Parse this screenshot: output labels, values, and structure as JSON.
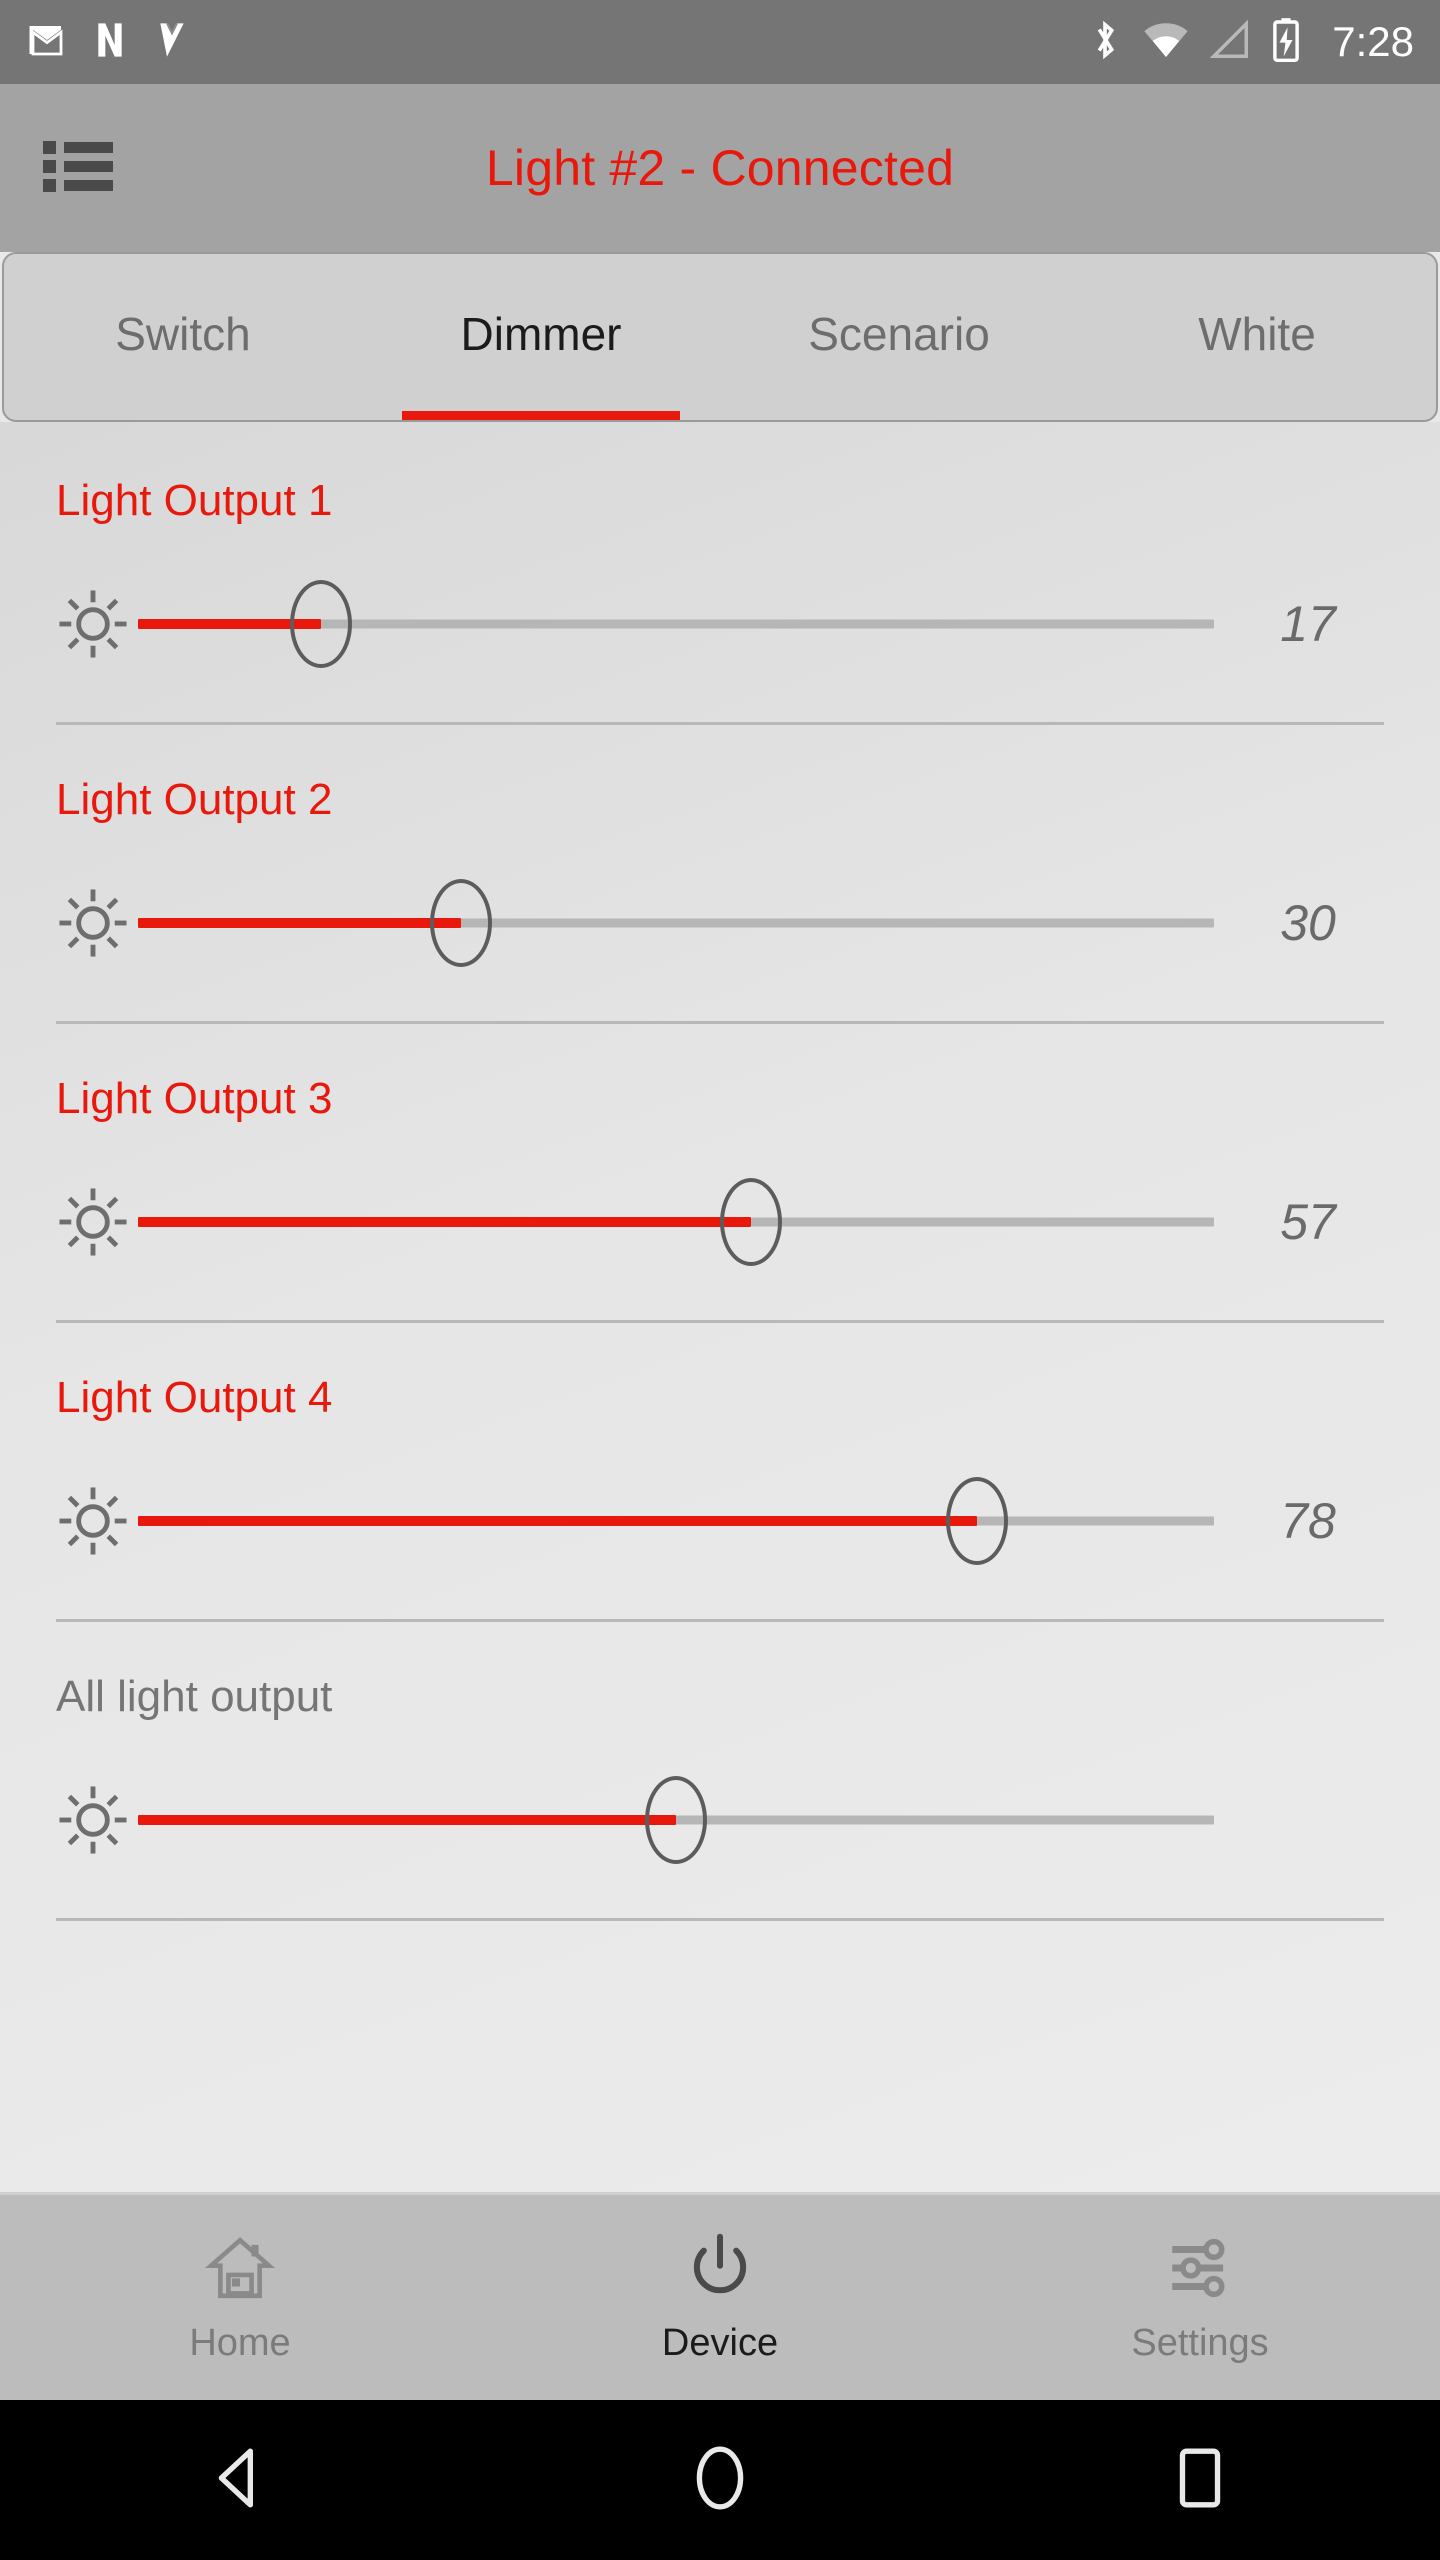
{
  "status_bar": {
    "left_icons": [
      "gmail-icon",
      "netflix-icon",
      "vlc-icon"
    ],
    "right_icons": [
      "bluetooth-icon",
      "wifi-icon",
      "cell-signal-icon",
      "battery-charging-icon"
    ],
    "time": "7:28"
  },
  "app_bar": {
    "menu_icon": "list-menu-icon",
    "title": "Light #2 - Connected",
    "title_color": "#e8180c"
  },
  "tabs": [
    {
      "label": "Switch",
      "active": false
    },
    {
      "label": "Dimmer",
      "active": true
    },
    {
      "label": "Scenario",
      "active": false
    },
    {
      "label": "White",
      "active": false
    }
  ],
  "dimmer": {
    "accent_color": "#e8180c",
    "track_color": "#b6b6b6",
    "rows": [
      {
        "label": "Light Output 1",
        "icon": "brightness-sun-icon",
        "value": "17",
        "percent": 17,
        "label_muted": false,
        "show_value": true
      },
      {
        "label": "Light Output 2",
        "icon": "brightness-sun-icon",
        "value": "30",
        "percent": 30,
        "label_muted": false,
        "show_value": true
      },
      {
        "label": "Light Output 3",
        "icon": "brightness-sun-icon",
        "value": "57",
        "percent": 57,
        "label_muted": false,
        "show_value": true
      },
      {
        "label": "Light Output 4",
        "icon": "brightness-sun-icon",
        "value": "78",
        "percent": 78,
        "label_muted": false,
        "show_value": true
      },
      {
        "label": "All light output",
        "icon": "brightness-sun-icon",
        "value": "",
        "percent": 50,
        "label_muted": true,
        "show_value": false
      }
    ]
  },
  "bottom_nav": [
    {
      "label": "Home",
      "icon": "home-icon",
      "active": false
    },
    {
      "label": "Device",
      "icon": "power-icon",
      "active": true
    },
    {
      "label": "Settings",
      "icon": "sliders-icon",
      "active": false
    }
  ],
  "android_nav": [
    {
      "icon": "back-triangle-icon"
    },
    {
      "icon": "home-circle-icon"
    },
    {
      "icon": "recents-square-icon"
    }
  ]
}
